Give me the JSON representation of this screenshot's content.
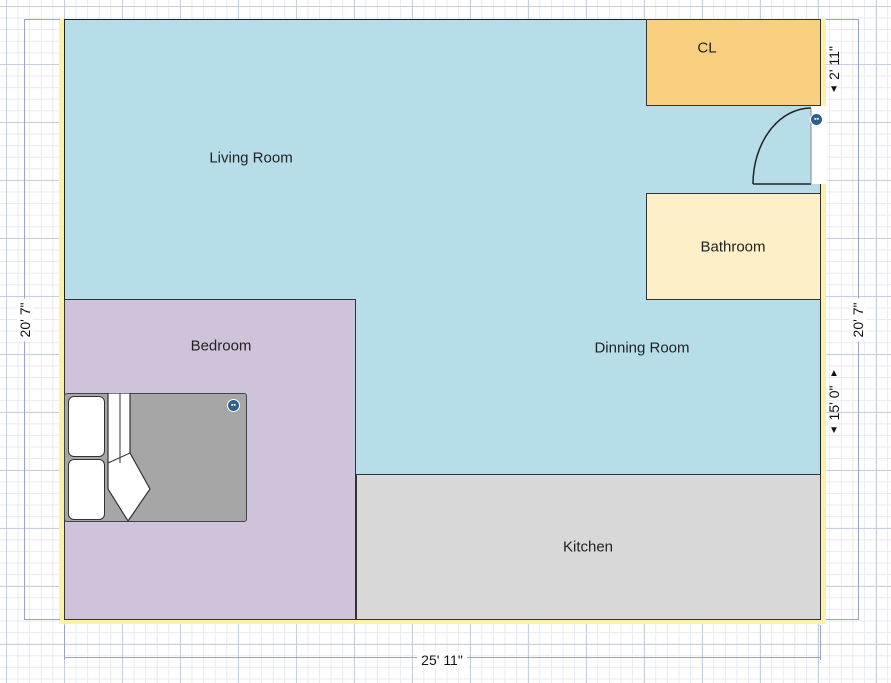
{
  "rooms": {
    "living_room": "Living Room",
    "dining_room": "Dinning Room",
    "bedroom": "Bedroom",
    "bathroom": "Bathroom",
    "closet": "CL",
    "kitchen": "Kitchen"
  },
  "dimensions": {
    "width_bottom": "25' 11\"",
    "height_left": "20' 7\"",
    "height_right": "20' 7\"",
    "closet_height": "2' 11\"",
    "dining_height": "15' 0\""
  },
  "colors": {
    "living": "#b7dde9",
    "bedroom": "#cfc3dc",
    "closet": "#f7cf7f",
    "bathroom": "#fdf0c8",
    "kitchen": "#d8d8d8",
    "bed": "#a6a6a6"
  },
  "icons": {
    "info_badge": "info-icon"
  }
}
